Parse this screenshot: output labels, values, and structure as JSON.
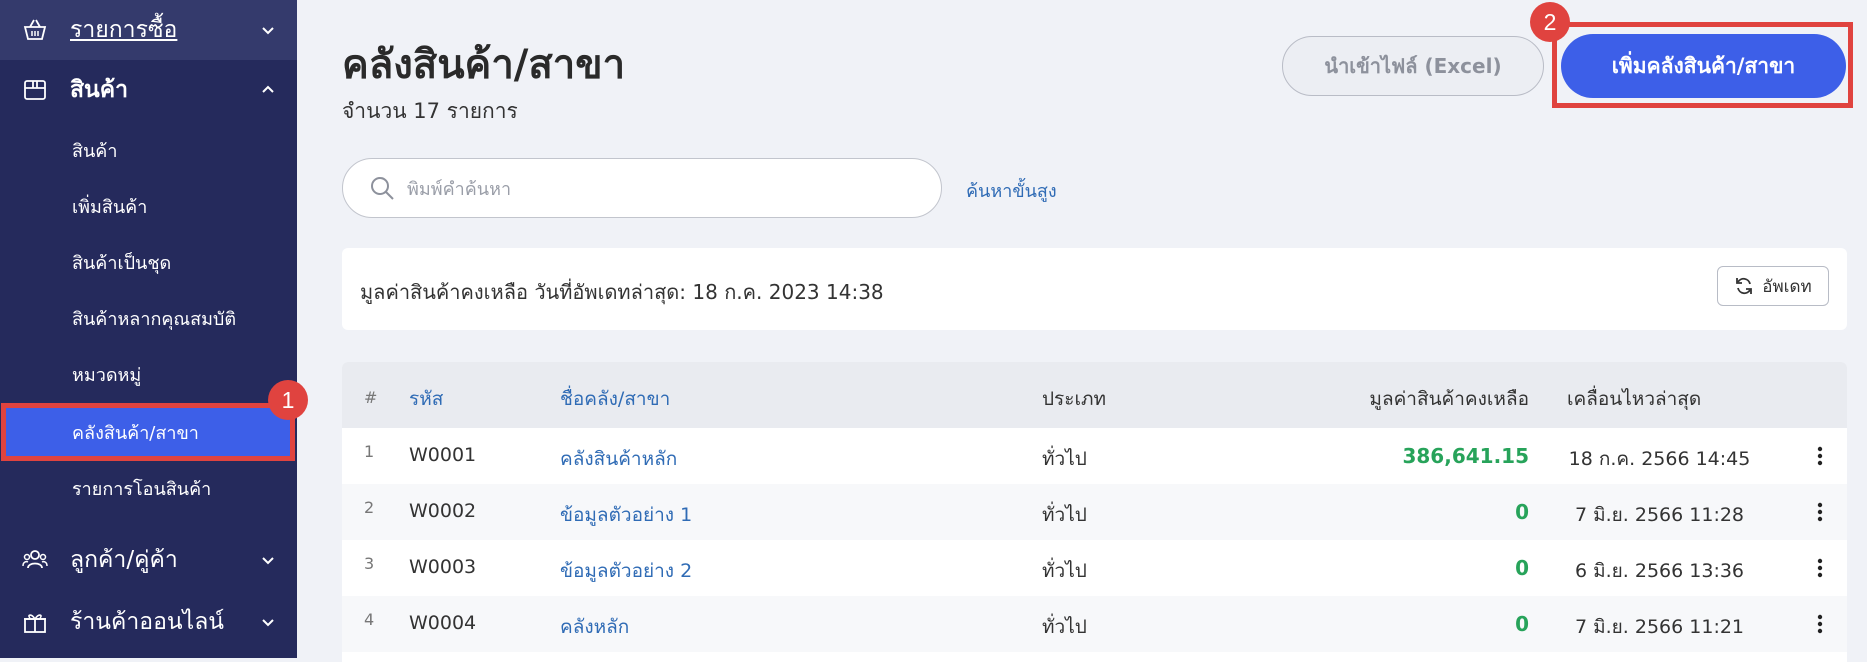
{
  "sidebar": {
    "purchase": {
      "label": "รายการซื้อ",
      "icon": "basket-icon"
    },
    "products": {
      "label": "สินค้า",
      "icon": "box-icon"
    },
    "sub_items": [
      {
        "label": "สินค้า"
      },
      {
        "label": "เพิ่มสินค้า"
      },
      {
        "label": "สินค้าเป็นชุด"
      },
      {
        "label": "สินค้าหลากคุณสมบัติ"
      },
      {
        "label": "หมวดหมู่"
      },
      {
        "label": "คลังสินค้า/สาขา",
        "active": true
      },
      {
        "label": "รายการโอนสินค้า"
      }
    ],
    "customers": {
      "label": "ลูกค้า/คู่ค้า",
      "icon": "users-icon"
    },
    "online_store": {
      "label": "ร้านค้าออนไลน์",
      "icon": "gift-store-icon"
    }
  },
  "annotations": {
    "badge_1": "1",
    "badge_2": "2",
    "color": "#e0433f"
  },
  "header": {
    "title": "คลังสินค้า/สาขา",
    "subtitle": "จำนวน 17 รายการ",
    "import_label": "นำเข้าไฟล์ (Excel)",
    "add_label": "เพิ่มคลังสินค้า/สาขา"
  },
  "search": {
    "placeholder": "พิมพ์คำค้นหา",
    "advanced_label": "ค้นหาขั้นสูง"
  },
  "summary": {
    "text": "มูลค่าสินค้าคงเหลือ วันที่อัพเดทล่าสุด: 18 ก.ค. 2023 14:38",
    "update_label": "อัพเดท"
  },
  "table": {
    "headers": {
      "idx": "#",
      "code": "รหัส",
      "name": "ชื่อคลัง/สาขา",
      "type": "ประเภท",
      "value": "มูลค่าสินค้าคงเหลือ",
      "moved": "เคลื่อนไหวล่าสุด"
    },
    "rows": [
      {
        "idx": "1",
        "code": "W0001",
        "name": "คลังสินค้าหลัก",
        "type": "ทั่วไป",
        "value": "386,641.15",
        "moved": "18 ก.ค. 2566 14:45"
      },
      {
        "idx": "2",
        "code": "W0002",
        "name": "ข้อมูลตัวอย่าง 1",
        "type": "ทั่วไป",
        "value": "0",
        "moved": "7 มิ.ย. 2566 11:28"
      },
      {
        "idx": "3",
        "code": "W0003",
        "name": "ข้อมูลตัวอย่าง 2",
        "type": "ทั่วไป",
        "value": "0",
        "moved": "6 มิ.ย. 2566 13:36"
      },
      {
        "idx": "4",
        "code": "W0004",
        "name": "คลังหลัก",
        "type": "ทั่วไป",
        "value": "0",
        "moved": "7 มิ.ย. 2566 11:21"
      }
    ]
  },
  "colors": {
    "sidebar_bg": "#252a5c",
    "accent": "#3d5fe8",
    "positive": "#27a35a",
    "link": "#2f6bb5"
  }
}
